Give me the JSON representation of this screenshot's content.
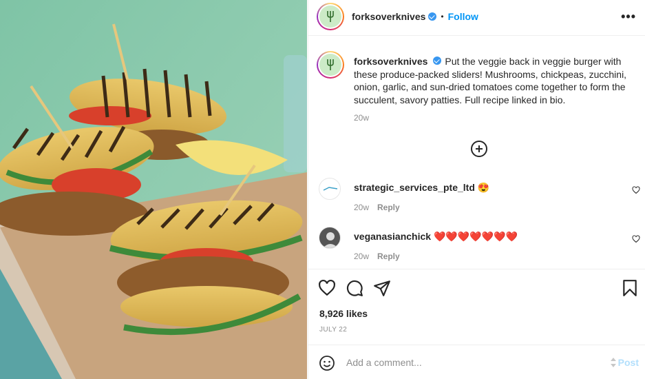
{
  "photo": {
    "alt_subject": "grilled-veggie-burger-sliders-photo"
  },
  "header": {
    "username": "forksoverknives",
    "separator": "•",
    "follow_label": "Follow",
    "more_label": "•••"
  },
  "caption": {
    "username": "forksoverknives",
    "text": "Put the veggie back in veggie burger with these produce-packed sliders! Mushrooms, chickpeas, zucchini, onion, garlic, and sun-dried tomatoes come together to form the succulent, savory patties. Full recipe linked in bio.",
    "time": "20w"
  },
  "comments": [
    {
      "username": "strategic_services_pte_ltd",
      "emoji": "😍",
      "time": "20w",
      "reply_label": "Reply"
    },
    {
      "username": "veganasianchick",
      "emoji": "❤️❤️❤️❤️❤️❤️❤️",
      "time": "20w",
      "reply_label": "Reply"
    }
  ],
  "actions": {
    "likes": "8,926 likes",
    "date": "JULY 22"
  },
  "add_comment": {
    "placeholder": "Add a comment...",
    "post_label": "Post"
  },
  "colors": {
    "accent": "#0095f6",
    "verified": "#3897f0",
    "post_disabled": "#b2dffc",
    "muted": "#8e8e8e"
  }
}
